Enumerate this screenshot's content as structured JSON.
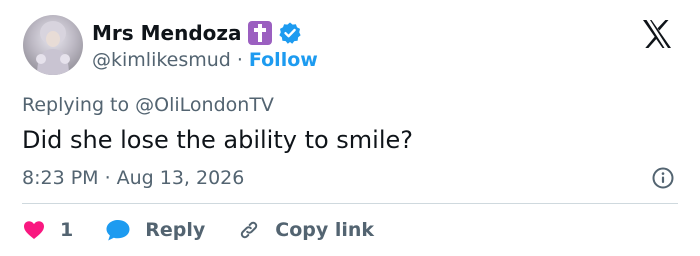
{
  "author": {
    "display_name": "Mrs Mendoza",
    "handle": "@kimlikesmud",
    "follow_label": "Follow",
    "separator": "·"
  },
  "tweet": {
    "replying_label": "Replying to",
    "replying_to": "@OliLondonTV",
    "text": "Did she lose the ability to smile?",
    "time": "8:23 PM",
    "date": "Aug 13, 2026",
    "meta_separator": "·"
  },
  "actions": {
    "like_count": "1",
    "reply_label": "Reply",
    "copy_label": "Copy link"
  },
  "colors": {
    "accent": "#1d9bf0",
    "like": "#f91880",
    "secondary_text": "#536471",
    "primary_text": "#0f1419",
    "divider": "#cfd9de",
    "cross_emoji_bg": "#9b5fc0"
  },
  "icons": {
    "emoji": "latin-cross-emoji",
    "verified": "verified-badge-icon",
    "logo": "x-logo-icon",
    "info": "info-icon",
    "like": "heart-icon",
    "reply": "speech-bubble-icon",
    "copy": "link-icon"
  }
}
